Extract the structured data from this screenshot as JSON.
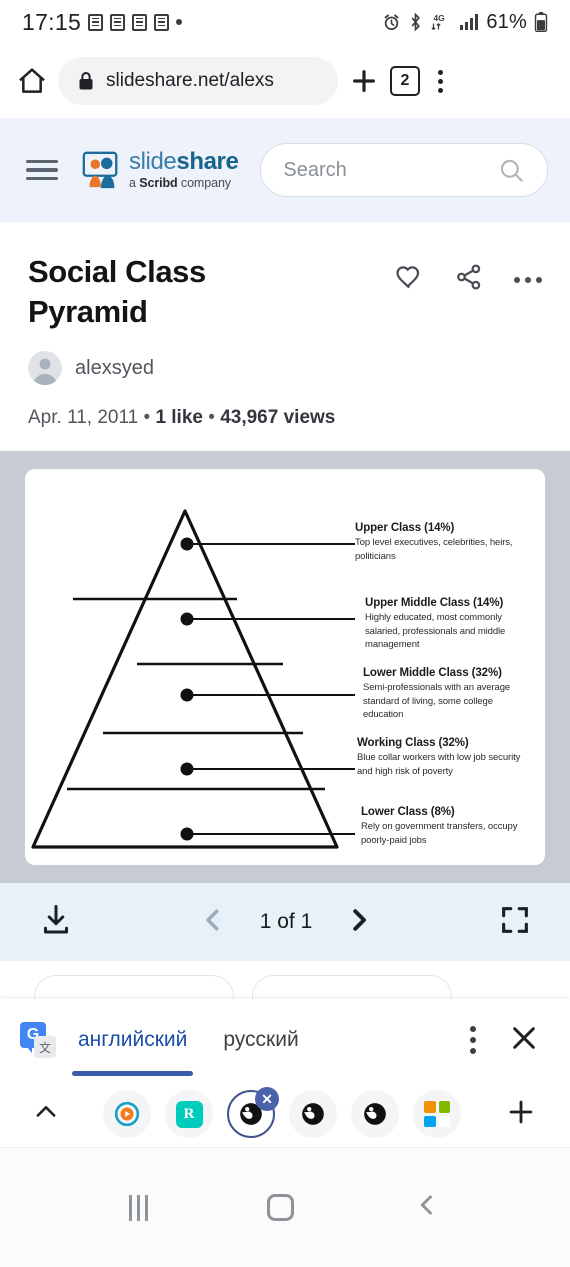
{
  "status_bar": {
    "time": "17:15",
    "battery_percent": "61%",
    "icons": [
      "note-icon",
      "note-icon",
      "note-icon",
      "note-icon",
      "dot-icon",
      "alarm-icon",
      "bluetooth-icon",
      "network-4g-icon",
      "signal-bars-icon",
      "battery-icon"
    ]
  },
  "browser": {
    "url": "slideshare.net/alexs",
    "tab_count": "2",
    "home_icon": "home-icon",
    "lock_icon": "lock-icon",
    "new_tab_icon": "plus-icon",
    "menu_icon": "kebab-menu-icon"
  },
  "site_header": {
    "logo_primary": "slide",
    "logo_bold": "share",
    "logo_sub_prefix": "a ",
    "logo_sub_bold": "Scribd",
    "logo_sub_suffix": " company",
    "search_placeholder": "Search",
    "menu_icon": "hamburger-icon",
    "search_icon": "search-icon"
  },
  "document": {
    "title": "Social Class Pyramid",
    "author": "alexsyed",
    "date": "Apr. 11, 2011",
    "likes": "1 like",
    "views": "43,967 views",
    "separator": " • ",
    "like_icon": "heart-icon",
    "share_icon": "share-icon",
    "more_icon": "more-horizontal-icon"
  },
  "slide_toolbar": {
    "download_icon": "download-icon",
    "prev_icon": "chevron-left-icon",
    "page_label": "1 of 1",
    "next_icon": "chevron-right-icon",
    "fullscreen_icon": "fullscreen-icon"
  },
  "translate_bar": {
    "icon": "google-translate-icon",
    "source_lang": "английский",
    "target_lang": "русский",
    "menu_icon": "kebab-menu-icon",
    "close_icon": "close-icon",
    "gt_g": "G",
    "gt_char": "文"
  },
  "tab_strip": {
    "expand_icon": "chevron-up-icon",
    "add_icon": "plus-icon",
    "tabs": [
      {
        "name": "media-player-tab",
        "icon": "play-circle-icon",
        "active": false
      },
      {
        "name": "researchgate-tab",
        "icon": "researchgate-icon",
        "label": "R",
        "active": false
      },
      {
        "name": "slideshare-tab",
        "icon": "globe-icon",
        "active": true,
        "close_icon": "close-badge-icon"
      },
      {
        "name": "browser-tab-2",
        "icon": "globe-icon",
        "active": false
      },
      {
        "name": "browser-tab-3",
        "icon": "globe-icon",
        "active": false
      },
      {
        "name": "office-tab",
        "icon": "microsoft-grid-icon",
        "active": false
      }
    ]
  },
  "nav_bar": {
    "recents_icon": "recents-icon",
    "home_icon": "home-square-icon",
    "back_icon": "back-chevron-icon"
  },
  "colors": {
    "accent_blue": "#3b5ca8",
    "header_bg": "#eef2fa",
    "viewer_bg": "#c7cbd3",
    "toolbar_bg": "#e7f1f8",
    "logo_blue": "#17648f",
    "logo_orange": "#e8762c"
  },
  "chart_data": {
    "type": "pyramid",
    "title": "Social Class Pyramid",
    "tiers": [
      {
        "name": "Upper Class",
        "percent": "14%",
        "label": "Upper Class (14%)",
        "description": "Top level executives, celebrities, heirs, politicians",
        "value": 14
      },
      {
        "name": "Upper Middle Class",
        "percent": "14%",
        "label": "Upper Middle Class (14%)",
        "description": "Highly educated, most commonly salaried, professionals and middle management",
        "value": 14
      },
      {
        "name": "Lower Middle Class",
        "percent": "32%",
        "label": "Lower Middle Class (32%)",
        "description": "Semi-professionals with an average standard of living, some college education",
        "value": 32
      },
      {
        "name": "Working Class",
        "percent": "32%",
        "label": "Working Class (32%)",
        "description": "Blue collar workers with low job security and high risk of poverty",
        "value": 32
      },
      {
        "name": "Lower Class",
        "percent": "8%",
        "label": "Lower Class (8%)",
        "description": "Rely on government transfers, occupy poorly-paid jobs",
        "value": 8
      }
    ]
  }
}
